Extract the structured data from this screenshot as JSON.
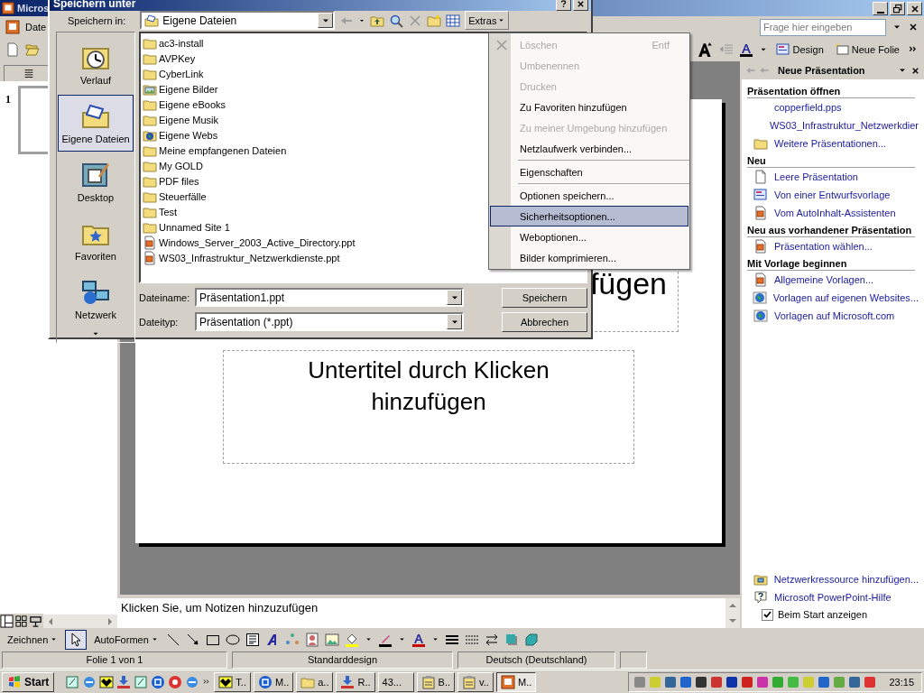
{
  "app": {
    "title": "Micros",
    "menu_fragment": "Date",
    "ask_placeholder": "Frage hier eingeben",
    "toolbar_buttons": [
      {
        "label": "Design",
        "kind": "design"
      },
      {
        "label": "Neue Folie",
        "kind": "new-slide"
      }
    ]
  },
  "slides_pane": {
    "thumbnails": [
      {
        "number": "1"
      }
    ]
  },
  "slide": {
    "title_visible": "fügen",
    "subtitle": "Untertitel durch Klicken hinzufügen"
  },
  "notes": {
    "text": "Klicken Sie, um Notizen hinzuzufügen"
  },
  "task_pane": {
    "title": "Neue Präsentation",
    "sections": [
      {
        "heading": "Präsentation öffnen",
        "items": [
          {
            "label": "copperfield.pps",
            "kind": "none"
          },
          {
            "label": "WS03_Infrastruktur_Netzwerkdier",
            "kind": "none"
          },
          {
            "label": "Weitere Präsentationen...",
            "kind": "folder"
          }
        ]
      },
      {
        "heading": "Neu",
        "items": [
          {
            "label": "Leere Präsentation",
            "kind": "page"
          },
          {
            "label": "Von einer Entwurfsvorlage",
            "kind": "design"
          },
          {
            "label": "Vom AutoInhalt-Assistenten",
            "kind": "ppt"
          }
        ]
      },
      {
        "heading": "Neu aus vorhandener Präsentation",
        "items": [
          {
            "label": "Präsentation wählen...",
            "kind": "ppt"
          }
        ]
      },
      {
        "heading": "Mit Vorlage beginnen",
        "items": [
          {
            "label": "Allgemeine Vorlagen...",
            "kind": "ppt"
          },
          {
            "label": "Vorlagen auf eigenen Websites...",
            "kind": "globe"
          },
          {
            "label": "Vorlagen auf Microsoft.com",
            "kind": "globe"
          }
        ]
      }
    ],
    "footer": [
      {
        "label": "Netzwerkressource hinzufügen...",
        "kind": "network"
      },
      {
        "label": "Microsoft PowerPoint-Hilfe",
        "kind": "help"
      }
    ],
    "show_at_start": {
      "label": "Beim Start anzeigen",
      "checked": true
    }
  },
  "drawing_toolbar": {
    "draw_menu": "Zeichnen",
    "select_tool_selected": true,
    "autoshapes": "AutoFormen"
  },
  "status_bar": [
    "Folie 1 von 1",
    "Standarddesign",
    "Deutsch (Deutschland)"
  ],
  "taskbar": {
    "start": "Start",
    "tasks": [
      {
        "label": "T..",
        "kind": "app",
        "selected": false
      },
      {
        "label": "M..",
        "kind": "circle",
        "selected": false
      },
      {
        "label": "a..",
        "kind": "folder",
        "selected": false
      },
      {
        "label": "R..",
        "kind": "download",
        "selected": false
      },
      {
        "label": "43...",
        "kind": "none",
        "selected": false
      },
      {
        "label": "B..",
        "kind": "clipboard",
        "selected": false
      },
      {
        "label": "v..",
        "kind": "clipboard",
        "selected": false
      },
      {
        "label": "M..",
        "kind": "ppt",
        "selected": true
      }
    ],
    "clock": "23:15"
  },
  "dialog": {
    "title": "Speichern unter",
    "save_in_label": "Speichern in:",
    "save_in": "Eigene Dateien",
    "extras": "Extras",
    "places": [
      {
        "label": "Verlauf",
        "kind": "history",
        "selected": false
      },
      {
        "label": "Eigene Dateien",
        "kind": "documents",
        "selected": true
      },
      {
        "label": "Desktop",
        "kind": "desktop",
        "selected": false
      },
      {
        "label": "Favoriten",
        "kind": "favorites",
        "selected": false
      },
      {
        "label": "Netzwerk",
        "kind": "network",
        "selected": false
      }
    ],
    "files": [
      {
        "name": "ac3-install",
        "kind": "folder"
      },
      {
        "name": "AVPKey",
        "kind": "folder"
      },
      {
        "name": "CyberLink",
        "kind": "folder"
      },
      {
        "name": "Eigene Bilder",
        "kind": "pictures"
      },
      {
        "name": "Eigene eBooks",
        "kind": "folder"
      },
      {
        "name": "Eigene Musik",
        "kind": "folder"
      },
      {
        "name": "Eigene Webs",
        "kind": "web"
      },
      {
        "name": "Meine empfangenen Dateien",
        "kind": "folder"
      },
      {
        "name": "My GOLD",
        "kind": "folder"
      },
      {
        "name": "PDF files",
        "kind": "folder"
      },
      {
        "name": "Steuerfälle",
        "kind": "folder"
      },
      {
        "name": "Test",
        "kind": "folder"
      },
      {
        "name": "Unnamed Site 1",
        "kind": "folder"
      },
      {
        "name": "Windows_Server_2003_Active_Directory.ppt",
        "kind": "ppt"
      },
      {
        "name": "WS03_Infrastruktur_Netzwerkdienste.ppt",
        "kind": "ppt"
      }
    ],
    "file_name_label": "Dateiname:",
    "file_name": "Präsentation1.ppt",
    "file_type_label": "Dateityp:",
    "file_type": "Präsentation (*.ppt)",
    "buttons": [
      "Speichern",
      "Abbrechen"
    ]
  },
  "extras_menu": [
    {
      "kind": "icon-item",
      "label": "Löschen",
      "shortcut": "Entf",
      "disabled": true,
      "selected": false
    },
    {
      "kind": "item",
      "label": "Umbenennen",
      "disabled": true,
      "selected": false
    },
    {
      "kind": "item",
      "label": "Drucken",
      "disabled": true,
      "selected": false
    },
    {
      "kind": "item",
      "label": "Zu Favoriten hinzufügen",
      "disabled": false,
      "selected": false
    },
    {
      "kind": "item",
      "label": "Zu meiner Umgebung hinzufügen",
      "disabled": true,
      "selected": false
    },
    {
      "kind": "item",
      "label": "Netzlaufwerk verbinden...",
      "disabled": false,
      "selected": false
    },
    {
      "kind": "separator"
    },
    {
      "kind": "item",
      "label": "Eigenschaften",
      "disabled": false,
      "selected": false
    },
    {
      "kind": "separator"
    },
    {
      "kind": "item",
      "label": "Optionen speichern...",
      "disabled": false,
      "selected": false
    },
    {
      "kind": "item",
      "label": "Sicherheitsoptionen...",
      "disabled": false,
      "selected": true
    },
    {
      "kind": "item",
      "label": "Weboptionen...",
      "disabled": false,
      "selected": false
    },
    {
      "kind": "item",
      "label": "Bilder komprimieren...",
      "disabled": false,
      "selected": false
    }
  ]
}
